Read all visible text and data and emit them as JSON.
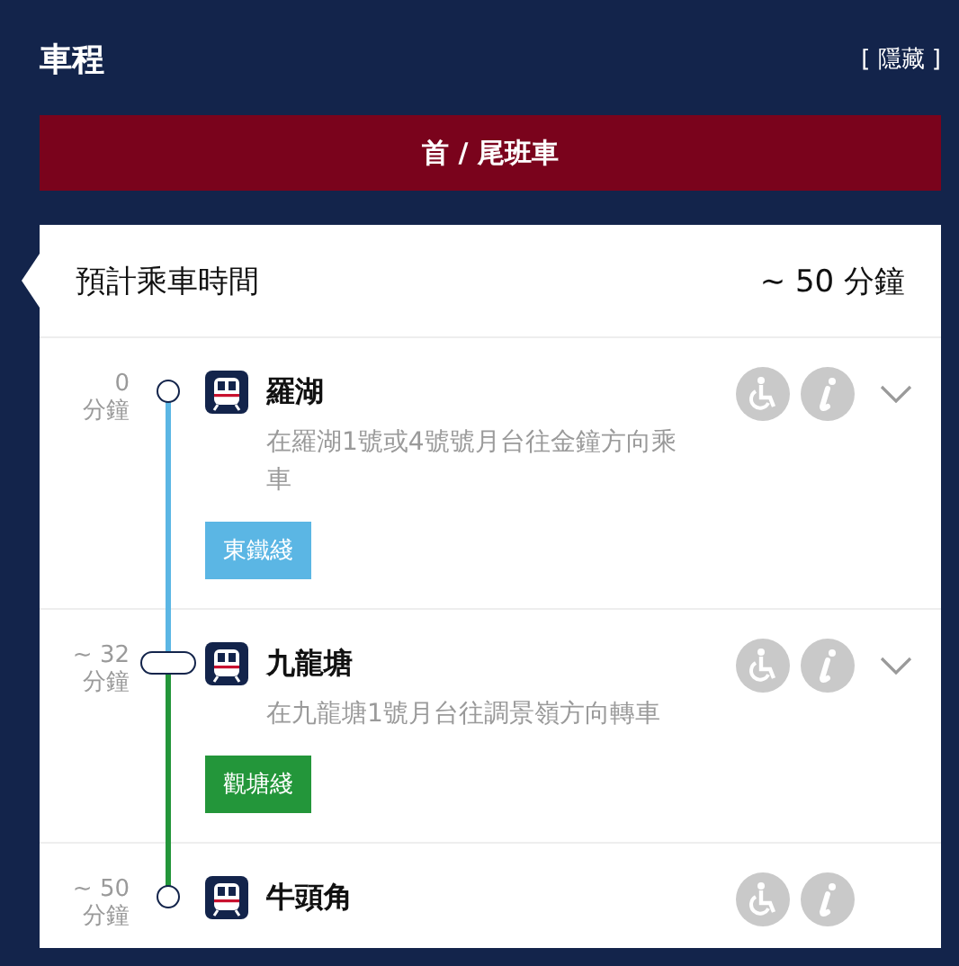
{
  "header": {
    "title": "車程",
    "toggle": "[ 隱藏 ]"
  },
  "first_last_button": "首 / 尾班車",
  "journey": {
    "label": "預計乘車時間",
    "duration": "~ 50 分鐘"
  },
  "stops": [
    {
      "time": "0",
      "unit": "分鐘",
      "kind": "station",
      "name": "羅湖",
      "note": "在羅湖1號或4號號月台往金鐘方向乘車",
      "badge": {
        "label": "東鐵綫",
        "color": "#5bb6e4"
      },
      "color": "#5bb6e4",
      "expandable": true
    },
    {
      "time": "~ 32",
      "unit": "分鐘",
      "kind": "interchange",
      "name": "九龍塘",
      "note": "在九龍塘1號月台往調景嶺方向轉車",
      "badge": {
        "label": "觀塘綫",
        "color": "#23963a"
      },
      "color": "#23963a",
      "expandable": true
    },
    {
      "time": "~ 50",
      "unit": "分鐘",
      "kind": "station",
      "name": "牛頭角",
      "expandable": false
    }
  ]
}
